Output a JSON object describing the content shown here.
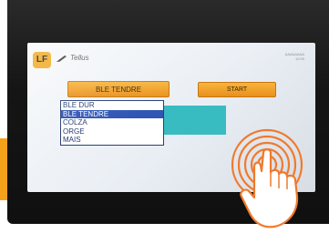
{
  "brand": {
    "logo_text": "LF",
    "name": "Tellus"
  },
  "header": {
    "info_line_1": "AAAAAAAA",
    "info_line_2": "12:00"
  },
  "product_selector": {
    "selected_label": "BLE TENDRE",
    "options": [
      "BLE DUR",
      "BLE TENDRE",
      "COLZA",
      "ORGE",
      "MAIS"
    ],
    "selected_index": 1
  },
  "actions": {
    "start_label": "START"
  },
  "colors": {
    "button_orange": "#f2a22a",
    "selection_blue": "#2f55b5",
    "panel_teal": "#38bcc2",
    "accent_orange": "#f3a21a",
    "touch_ripple": "#f07a2c"
  },
  "icons": {
    "logo": "company-logo-icon",
    "pen": "pen-icon",
    "touch": "hand-tap-icon"
  }
}
